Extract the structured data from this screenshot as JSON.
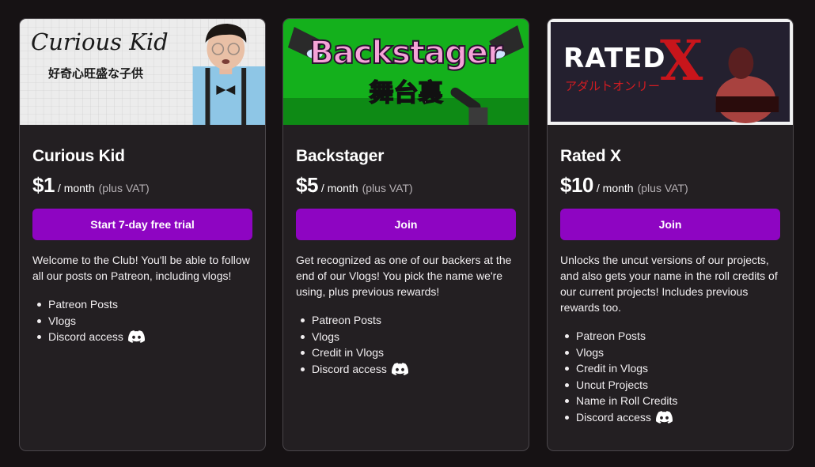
{
  "tiers": [
    {
      "banner_title": "Curious Kid",
      "banner_subtitle": "好奇心旺盛な子供",
      "name": "Curious Kid",
      "price": "$1",
      "period": "/ month",
      "vat": "(plus VAT)",
      "button": "Start 7-day free trial",
      "description": "Welcome to the Club! You'll be able to follow all our posts on Patreon, including vlogs!",
      "perks": [
        "Patreon Posts",
        "Vlogs",
        "Discord access"
      ]
    },
    {
      "banner_title": "Backstager",
      "banner_subtitle": "舞台裏",
      "name": "Backstager",
      "price": "$5",
      "period": "/ month",
      "vat": "(plus VAT)",
      "button": "Join",
      "description": "Get recognized as one of our backers at the end of our Vlogs! You pick the name we're using, plus previous rewards!",
      "perks": [
        "Patreon Posts",
        "Vlogs",
        "Credit in Vlogs",
        "Discord access"
      ]
    },
    {
      "banner_title": "RATED",
      "banner_title_x": "X",
      "banner_subtitle": "アダルトオンリー",
      "name": "Rated X",
      "price": "$10",
      "period": "/ month",
      "vat": "(plus VAT)",
      "button": "Join",
      "description": "Unlocks the uncut versions of our projects, and also gets your name in the roll credits of our current projects! Includes previous rewards too.",
      "perks": [
        "Patreon Posts",
        "Vlogs",
        "Credit in Vlogs",
        "Uncut Projects",
        "Name in Roll Credits",
        "Discord access"
      ]
    }
  ],
  "colors": {
    "accent": "#8e05c2",
    "card": "#231f22",
    "background": "#161214"
  },
  "icons": {
    "discord": "discord-icon"
  }
}
